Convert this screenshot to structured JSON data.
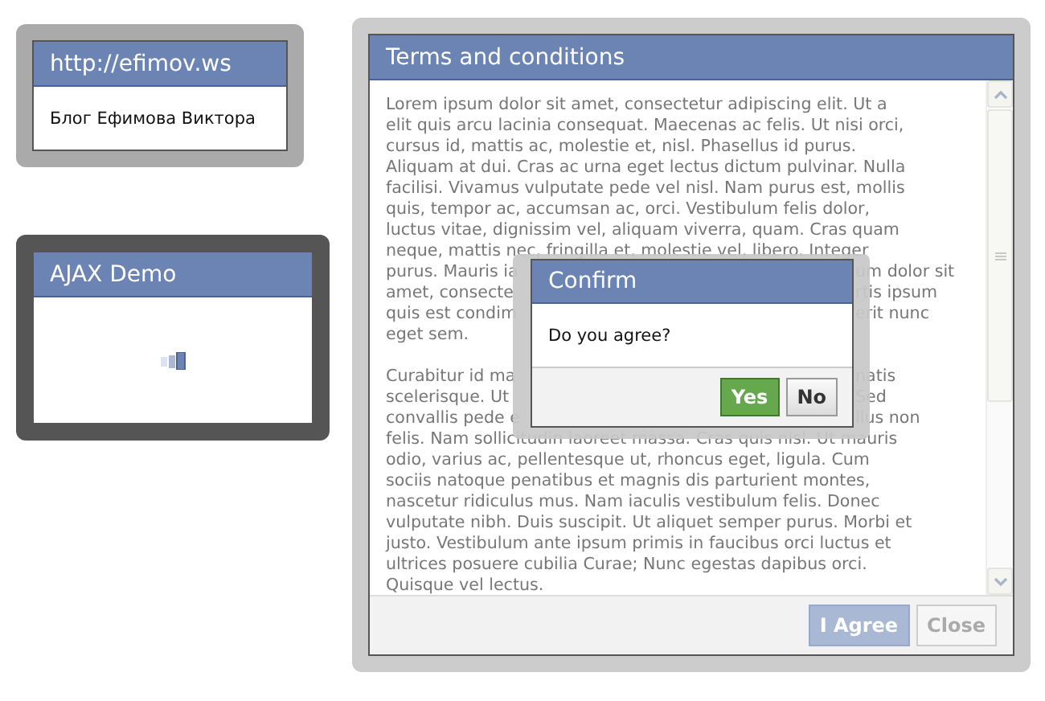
{
  "link_window": {
    "title": "http://efimov.ws",
    "text": "Блог Ефимова Виктора"
  },
  "ajax_window": {
    "title": "AJAX Demo",
    "loading": true
  },
  "terms_window": {
    "title": "Terms and conditions",
    "paragraphs": [
      [
        {
          "segments": [
            "Lorem ipsum dolor sit amet, consectetur adipiscing elit. Ut a"
          ]
        },
        {
          "segments": [
            "elit quis arcu lacinia consequat. Maecenas ac felis. Ut nisi orci,"
          ]
        },
        {
          "segments": [
            "cursus id, mattis ac, molestie et, nisl. Phasellus id purus."
          ]
        },
        {
          "segments": [
            "Aliquam at dui. Cras ac urna eget lectus dictum pulvinar. Nulla"
          ]
        },
        {
          "segments": [
            "facilisi. Vivamus vulputate pede vel nisl. Nam purus est, mollis"
          ]
        },
        {
          "segments": [
            "quis, tempor ac, accumsan ac, orci. Vestibulum felis dolor,"
          ]
        },
        {
          "segments": [
            "luctus vitae, dignissim vel, aliquam viverra, quam. Cras quam"
          ]
        },
        {
          "segments": [
            "neque, mattis nec, fringilla et, molestie vel, libero. Integer"
          ]
        },
        {
          "segments": [
            "purus. Mauris ia",
            "um dolor sit"
          ]
        },
        {
          "segments": [
            "amet, consecte",
            "rtis ipsum"
          ]
        },
        {
          "segments": [
            "quis est condim",
            "erit nunc"
          ]
        },
        {
          "segments": [
            "eget sem."
          ]
        }
      ],
      [
        {
          "segments": [
            "Curabitur id ma",
            "natis"
          ]
        },
        {
          "segments": [
            "scelerisque. Ut",
            "Sed"
          ]
        },
        {
          "segments": [
            "convallis pede e",
            "llus non"
          ]
        },
        {
          "segments": [
            "felis. Nam sollicitudin laoreet massa. Cras quis nisl. Ut mauris"
          ]
        },
        {
          "segments": [
            "odio, varius ac, pellentesque ut, rhoncus eget, ligula. Cum"
          ]
        },
        {
          "segments": [
            "sociis natoque penatibus et magnis dis parturient montes,"
          ]
        },
        {
          "segments": [
            "nascetur ridiculus mus. Nam iaculis vestibulum felis. Donec"
          ]
        },
        {
          "segments": [
            "vulputate nibh. Duis suscipit. Ut aliquet semper purus. Morbi et"
          ]
        },
        {
          "segments": [
            "justo. Vestibulum ante ipsum primis in faucibus orci luctus et"
          ]
        },
        {
          "segments": [
            "ultrices posuere cubilia Curae; Nunc egestas dapibus orci."
          ]
        },
        {
          "segments": [
            "Quisque vel lectus."
          ]
        }
      ]
    ],
    "buttons": [
      {
        "label": "I Agree",
        "kind": "primary",
        "disabled": true
      },
      {
        "label": "Close",
        "kind": "default",
        "disabled": true
      }
    ]
  },
  "confirm_dialog": {
    "title": "Confirm",
    "message": "Do you agree?",
    "buttons": [
      {
        "label": "Yes",
        "kind": "primary",
        "disabled": false
      },
      {
        "label": "No",
        "kind": "default",
        "disabled": false
      }
    ]
  }
}
